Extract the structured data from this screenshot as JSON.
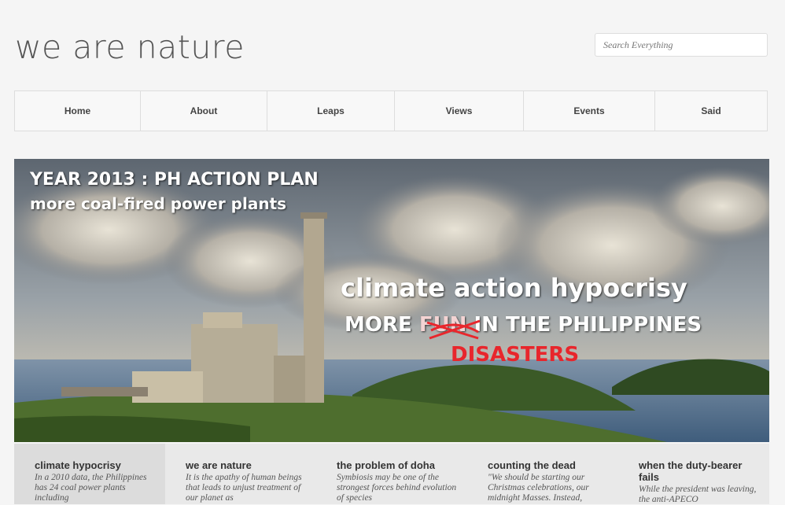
{
  "site": {
    "title": "we are nature"
  },
  "search": {
    "placeholder": "Search Everything"
  },
  "nav": {
    "items": [
      "Home",
      "About",
      "Leaps",
      "Views",
      "Events",
      "Said"
    ]
  },
  "hero": {
    "line1": "YEAR 2013 : PH ACTION PLAN",
    "line2": "more coal-fired power plants",
    "line3": "climate action hypocrisy",
    "line4_prefix": "MORE ",
    "line4_struck": "FUN",
    "line4_suffix": " IN THE PHILIPPINES",
    "line5": "DISASTERS",
    "colors": {
      "sky_top": "#6a7480",
      "sky_mid": "#9aa3ab",
      "sea": "#4f6f8c",
      "land": "#3d5a2a",
      "accent_red": "#e8262c"
    }
  },
  "cards": [
    {
      "title": "climate hypocrisy",
      "text": "In a 2010 data, the Philippines has 24 coal power plants including"
    },
    {
      "title": "we are nature",
      "text": "It is the apathy of human beings that leads to unjust treatment of our planet as"
    },
    {
      "title": "the problem of doha",
      "text": "Symbiosis may be one of the strongest forces behind evolution of species"
    },
    {
      "title": "counting the dead",
      "text": "\"We should be starting our Christmas celebrations, our midnight Masses. Instead,"
    },
    {
      "title": "when the duty-bearer fails",
      "text": "While the president was leaving, the anti-APECO"
    }
  ]
}
